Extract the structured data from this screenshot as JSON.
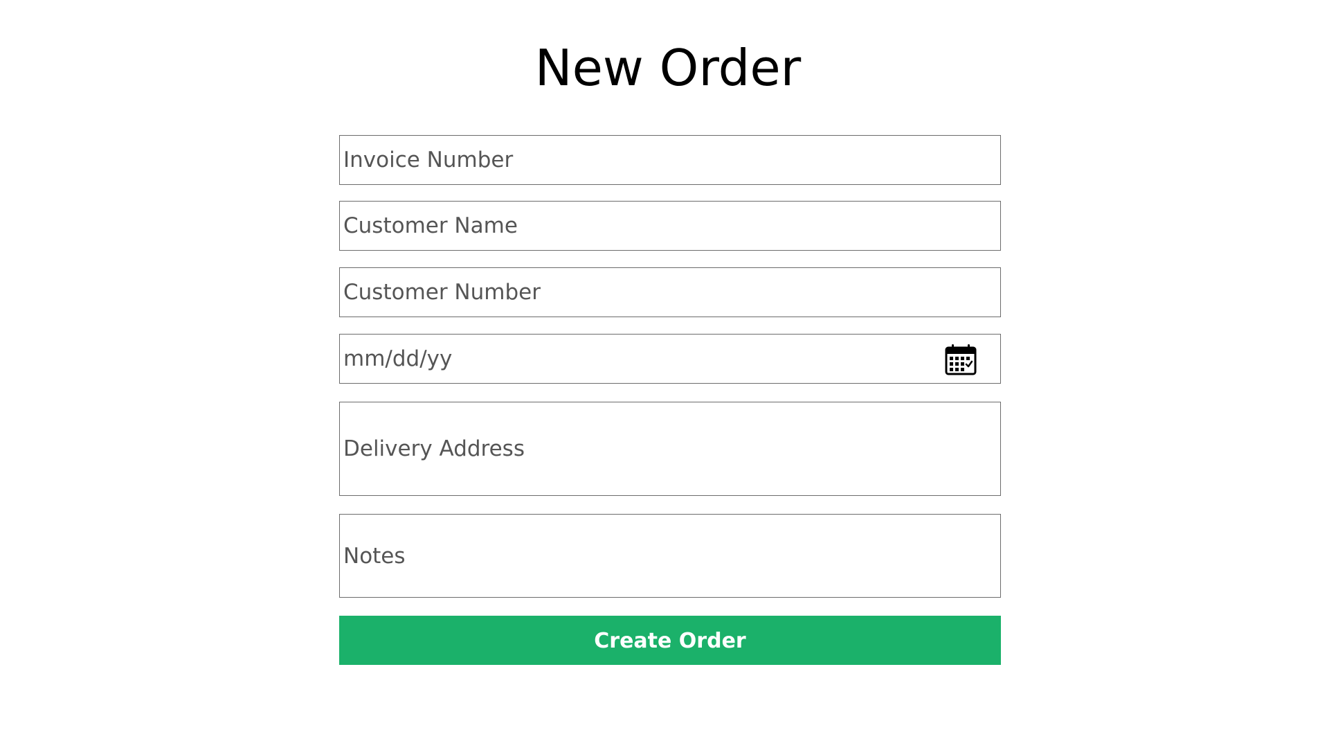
{
  "page": {
    "title": "New Order"
  },
  "form": {
    "invoice_number": {
      "placeholder": "Invoice Number",
      "value": ""
    },
    "customer_name": {
      "placeholder": "Customer Name",
      "value": ""
    },
    "customer_number": {
      "placeholder": "Customer Number",
      "value": ""
    },
    "date": {
      "placeholder": "mm/dd/yy",
      "value": "",
      "icon": "calendar-icon"
    },
    "delivery_address": {
      "placeholder": "Delivery Address",
      "value": ""
    },
    "notes": {
      "placeholder": "Notes",
      "value": ""
    },
    "submit_label": "Create Order"
  },
  "colors": {
    "button_background": "#1bb16a",
    "button_text": "#ffffff",
    "field_border": "#6b6b6b",
    "placeholder_text": "#555555",
    "title_text": "#000000"
  }
}
